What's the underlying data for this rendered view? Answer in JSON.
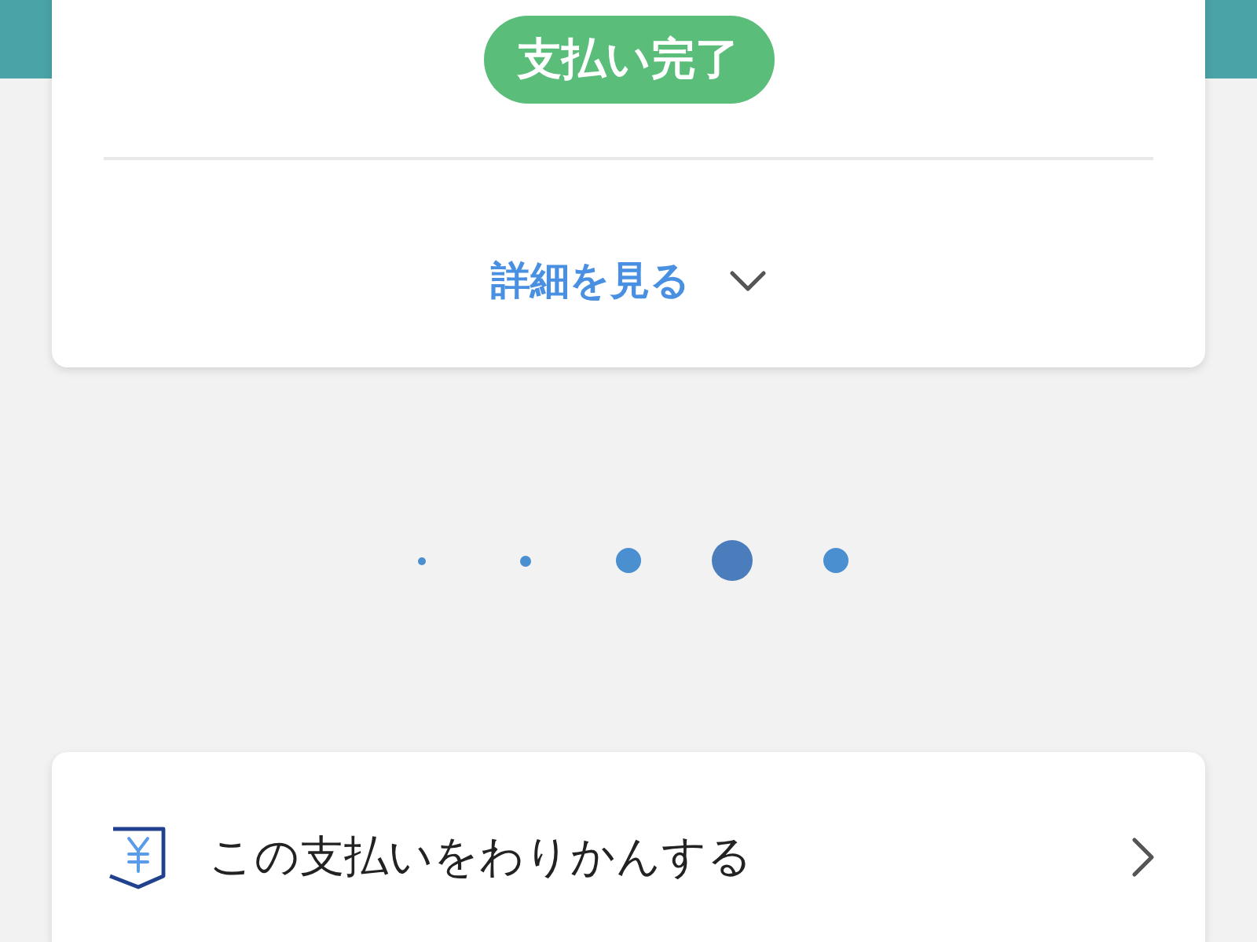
{
  "status_badge": {
    "label": "支払い完了"
  },
  "details_toggle": {
    "label": "詳細を見る",
    "expanded": false
  },
  "page_dots": [
    {
      "kind": "tiny",
      "selected": false
    },
    {
      "kind": "small",
      "selected": false
    },
    {
      "kind": "full",
      "selected": false
    },
    {
      "kind": "full",
      "selected": true
    },
    {
      "kind": "full",
      "selected": false
    }
  ],
  "actions": [
    {
      "label": "この支払いをわりかんする"
    }
  ]
}
